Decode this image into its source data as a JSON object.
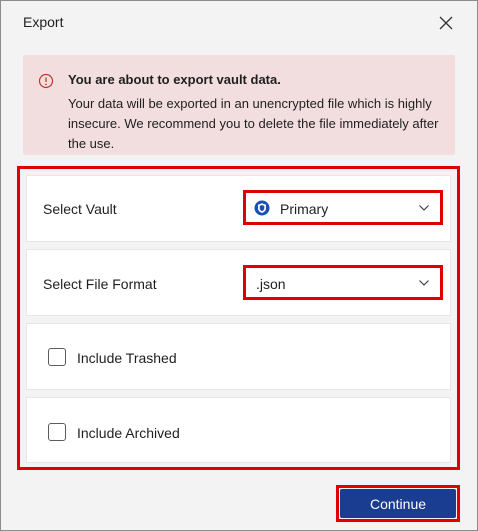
{
  "window": {
    "title": "Export"
  },
  "alert": {
    "heading": "You are about to export vault data.",
    "body": "Your data will be exported in an unencrypted file which is highly insecure. We recommend you to delete the file immediately after the use."
  },
  "form": {
    "vault": {
      "label": "Select Vault",
      "value": "Primary"
    },
    "format": {
      "label": "Select File Format",
      "value": ".json"
    },
    "include_trashed": {
      "label": "Include Trashed",
      "checked": false
    },
    "include_archived": {
      "label": "Include Archived",
      "checked": false
    }
  },
  "actions": {
    "continue_label": "Continue"
  },
  "colors": {
    "accent": "#1b3d91",
    "alert_background": "#f2dede",
    "alert_icon": "#c0392b",
    "highlight": "#e00000",
    "vault_icon": "#1b4fb6"
  },
  "icons": {
    "close": "close-icon",
    "alert": "info-circle-icon",
    "vault": "vault-shield-icon",
    "dropdown": "chevron-down-icon"
  }
}
